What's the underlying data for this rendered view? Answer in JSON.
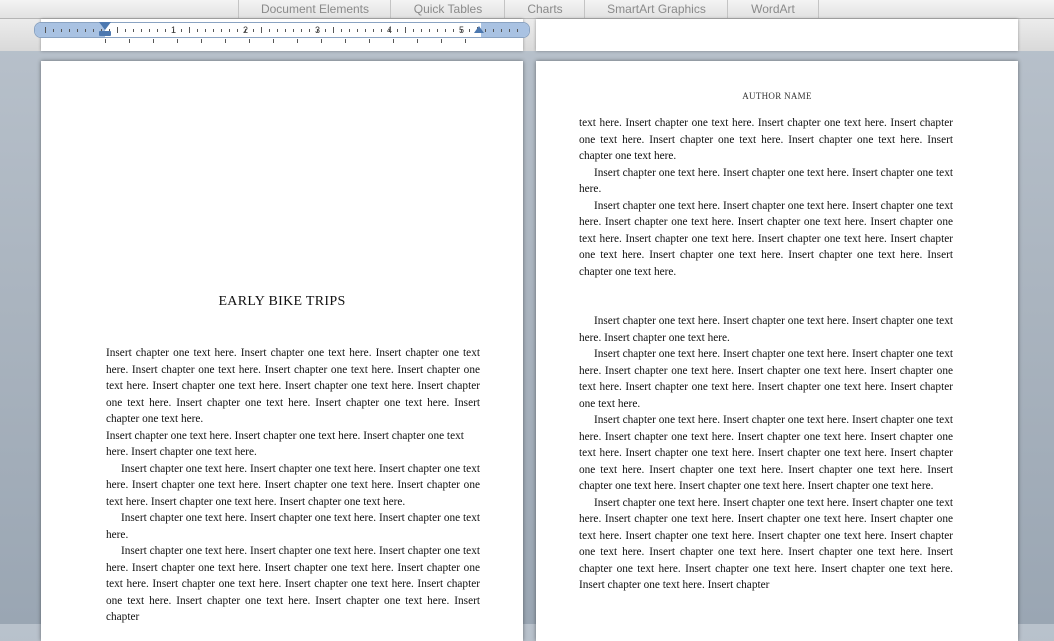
{
  "ribbon": {
    "tabs": [
      "Document Elements",
      "Quick Tables",
      "Charts",
      "SmartArt Graphics",
      "WordArt"
    ]
  },
  "ruler": {
    "numbers": [
      "1",
      "2",
      "3",
      "4",
      "5"
    ]
  },
  "left_page": {
    "chapter_title": "EARLY BIKE TRIPS",
    "paragraphs": [
      "Insert chapter one text here. Insert chapter one text here. Insert chapter one text here. Insert chapter one text here. Insert chapter one text here. Insert chapter one text here. Insert chapter one text here. Insert chapter one text here. Insert chapter one text here. Insert chapter one text here. Insert chapter one text here. Insert chapter one text here.",
      "Insert chapter one text here. Insert chapter one text here. Insert chapter one text here. Insert chapter one text here.",
      "Insert chapter one text here. Insert chapter one text here. Insert chapter one text here. Insert chapter one text here. Insert chapter one text here. Insert chapter one text here. Insert chapter one text here. Insert chapter one text here.",
      "Insert chapter one text here. Insert chapter one text here. Insert chapter one text here.",
      "Insert chapter one text here. Insert chapter one text here. Insert chapter one text here. Insert chapter one text here. Insert chapter one text here. Insert chapter one text here. Insert chapter one text here. Insert chapter one text here. Insert chapter one text here. Insert chapter one text here. Insert chapter one text here. Insert chapter"
    ]
  },
  "right_page": {
    "header": "AUTHOR NAME",
    "paragraphs": [
      "text here. Insert chapter one text here. Insert chapter one text here. Insert chapter one text here. Insert chapter one text here. Insert chapter one text here. Insert chapter one text here.",
      "Insert chapter one text here. Insert chapter one text here. Insert chapter one text here.",
      "Insert chapter one text here. Insert chapter one text here. Insert chapter one text here. Insert chapter one text here. Insert chapter one text here. Insert chapter one text here. Insert chapter one text here. Insert chapter one text here. Insert chapter one text here. Insert chapter one text here. Insert chapter one text here. Insert chapter one text here.",
      "Insert chapter one text here. Insert chapter one text here. Insert chapter one text here. Insert chapter one text here.",
      "Insert chapter one text here. Insert chapter one text here. Insert chapter one text here. Insert chapter one text here. Insert chapter one text here. Insert chapter one text here. Insert chapter one text here. Insert chapter one text here. Insert chapter one text here.",
      "Insert chapter one text here. Insert chapter one text here. Insert chapter one text here. Insert chapter one text here. Insert chapter one text here. Insert chapter one text here. Insert chapter one text here. Insert chapter one text here. Insert chapter one text here. Insert chapter one text here. Insert chapter one text here. Insert chapter one text here. Insert chapter one text here. Insert chapter one text here.",
      "Insert chapter one text here. Insert chapter one text here. Insert chapter one text here. Insert chapter one text here. Insert chapter one text here. Insert chapter one text here. Insert chapter one text here. Insert chapter one text here. Insert chapter one text here. Insert chapter one text here. Insert chapter one text here. Insert chapter one text here. Insert chapter one text here. Insert chapter one text here. Insert chapter one text here. Insert chapter"
    ]
  },
  "colors": {
    "ruler_margin": "#a9c2e2",
    "ruler_marker": "#4c78b0",
    "desktop": "#aab4bf"
  }
}
